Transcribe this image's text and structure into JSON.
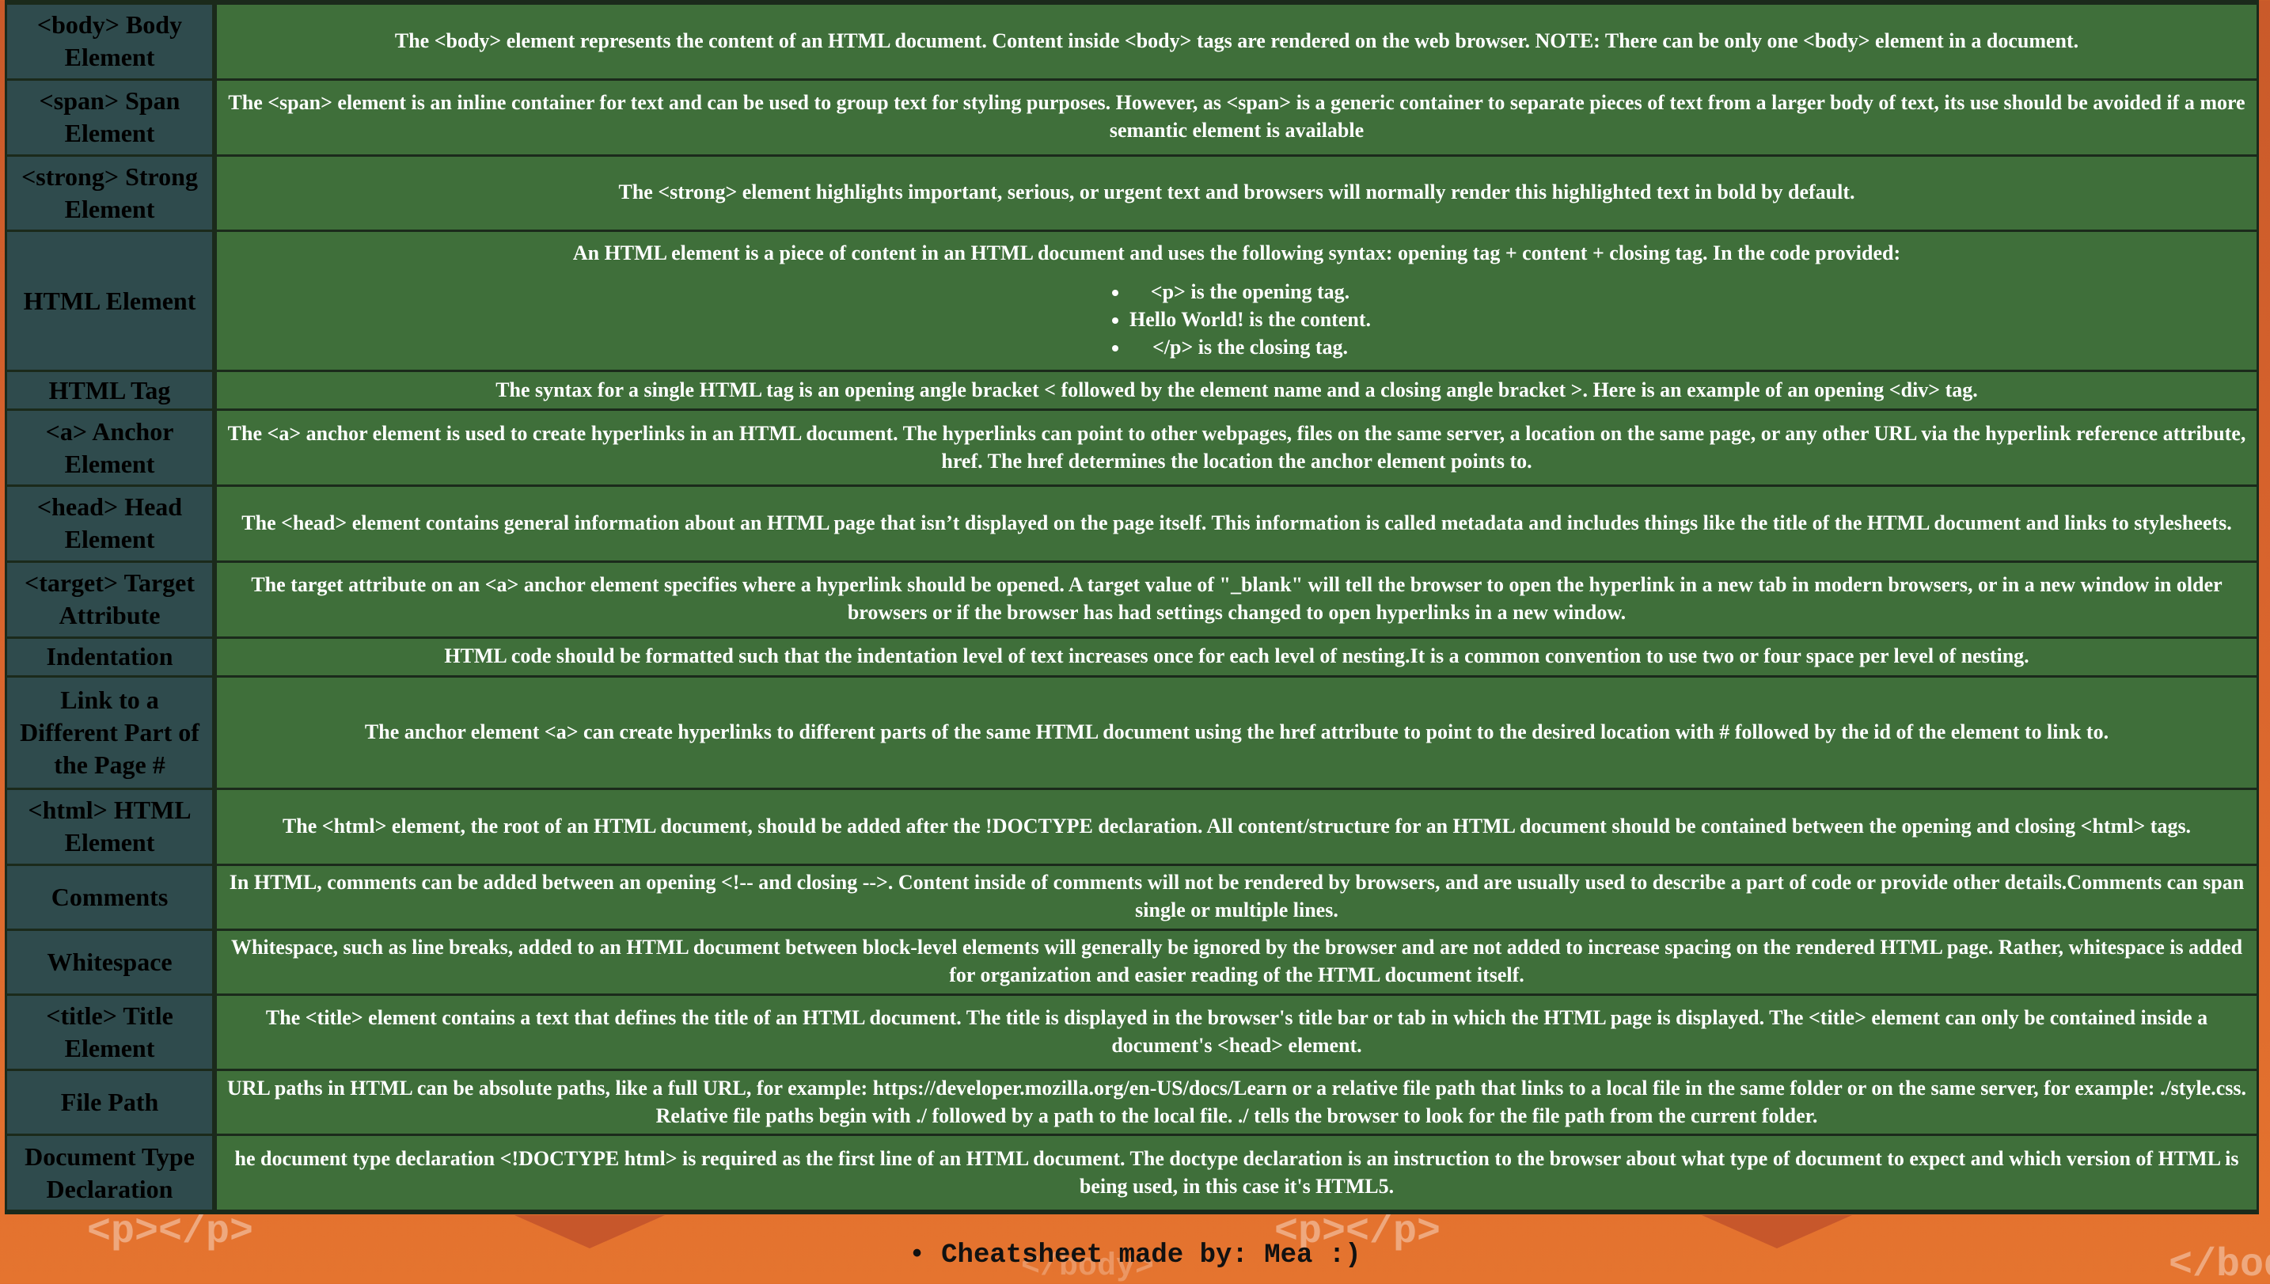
{
  "background": {
    "deco_left": "<p></p>",
    "deco_mid": "<p></p>",
    "deco_right": "</bod",
    "deco_footer": "</body>"
  },
  "rows": [
    {
      "term": "<body> Body Element",
      "definition": "The <body> element represents the content of an HTML document. Content inside <body> tags are rendered on the web browser. NOTE: There can be only one <body> element in a document."
    },
    {
      "term": "<span> Span Element",
      "definition": "The <span> element is an inline container for text and can be used to group text for styling purposes. However, as <span> is a generic container to separate pieces of text from a larger body of text, its use should be avoided if a more semantic element is available"
    },
    {
      "term": "<strong> Strong Element",
      "definition": "The <strong> element highlights important, serious, or urgent text and browsers will normally render this highlighted text in bold by default."
    },
    {
      "term": "HTML Element",
      "definition": "An HTML element is a piece of content in an HTML document and uses the following syntax: opening tag + content + closing tag. In the code provided:",
      "bullets": [
        "<p> is the opening tag.",
        "Hello World! is the content.",
        "</p> is the closing tag."
      ]
    },
    {
      "term": "HTML Tag",
      "definition": "The syntax for a single HTML tag is an opening angle bracket < followed by the element name and a closing angle bracket >. Here is an example of an opening <div> tag."
    },
    {
      "term": "<a> Anchor Element",
      "definition": "The <a> anchor element is used to create hyperlinks in an HTML document. The hyperlinks can point to other webpages, files on the same server, a location on the same page, or any other URL via the hyperlink reference attribute, href. The href determines the location the anchor element points to."
    },
    {
      "term": "<head> Head Element",
      "definition": "The <head> element contains general information about an HTML page that isn’t displayed on the page itself. This information is called metadata and includes things like the title of the HTML document and links to stylesheets."
    },
    {
      "term": "<target> Target Attribute",
      "definition": "The target attribute on an <a> anchor element specifies where a hyperlink should be opened. A target value of \"_blank\" will tell the browser to open the hyperlink in a new tab in modern browsers, or in a new window in older browsers or if the browser has had settings changed to open hyperlinks in a new window."
    },
    {
      "term": "Indentation",
      "definition": "HTML code should be formatted such that the indentation level of text increases once for each level of nesting.It is a common convention to use two or four space per level of nesting."
    },
    {
      "term": "Link to a Different Part of the Page #",
      "definition": "The anchor element <a> can create hyperlinks to different parts of the same HTML document using the href attribute to point to the desired location with # followed by the id of the element to link to."
    },
    {
      "term": "<html> HTML Element",
      "definition": "The <html> element, the root of an HTML document, should be added after the !DOCTYPE declaration. All content/structure for an HTML document should be contained between the opening and closing <html> tags."
    },
    {
      "term": "Comments",
      "definition": "In HTML, comments can be added between an opening <!-- and closing -->. Content inside of comments will not be rendered by browsers, and are usually used to describe a part of code or provide other details.Comments can span single or multiple lines."
    },
    {
      "term": "Whitespace",
      "definition": "Whitespace, such as line breaks, added to an HTML document between block-level elements will generally be ignored by the browser and are not added to increase spacing on the rendered HTML page. Rather, whitespace is added for organization and easier reading of the HTML document itself."
    },
    {
      "term": "<title> Title Element",
      "definition": "The <title> element contains a text that defines the title of an HTML document. The title is displayed in the browser's title bar or tab in which the HTML page is displayed. The <title> element can only be contained inside a document's <head> element."
    },
    {
      "term": "File Path",
      "definition": "URL paths in HTML can be absolute paths, like a full URL, for example: https://developer.mozilla.org/en-US/docs/Learn or a relative file path that links to a local file in the same folder or on the same server, for example: ./style.css. Relative file paths begin with ./ followed by a path to the local file. ./ tells the browser to look for the file path from the current folder."
    },
    {
      "term": "Document Type Declaration",
      "definition": "he document type declaration <!DOCTYPE html> is required as the first line of an HTML document. The doctype declaration is an instruction to the browser about what type of document to expect and which version of HTML is being used, in this case it's HTML5."
    }
  ],
  "footer": {
    "text": "• Cheatsheet made by: Mea :)"
  }
}
